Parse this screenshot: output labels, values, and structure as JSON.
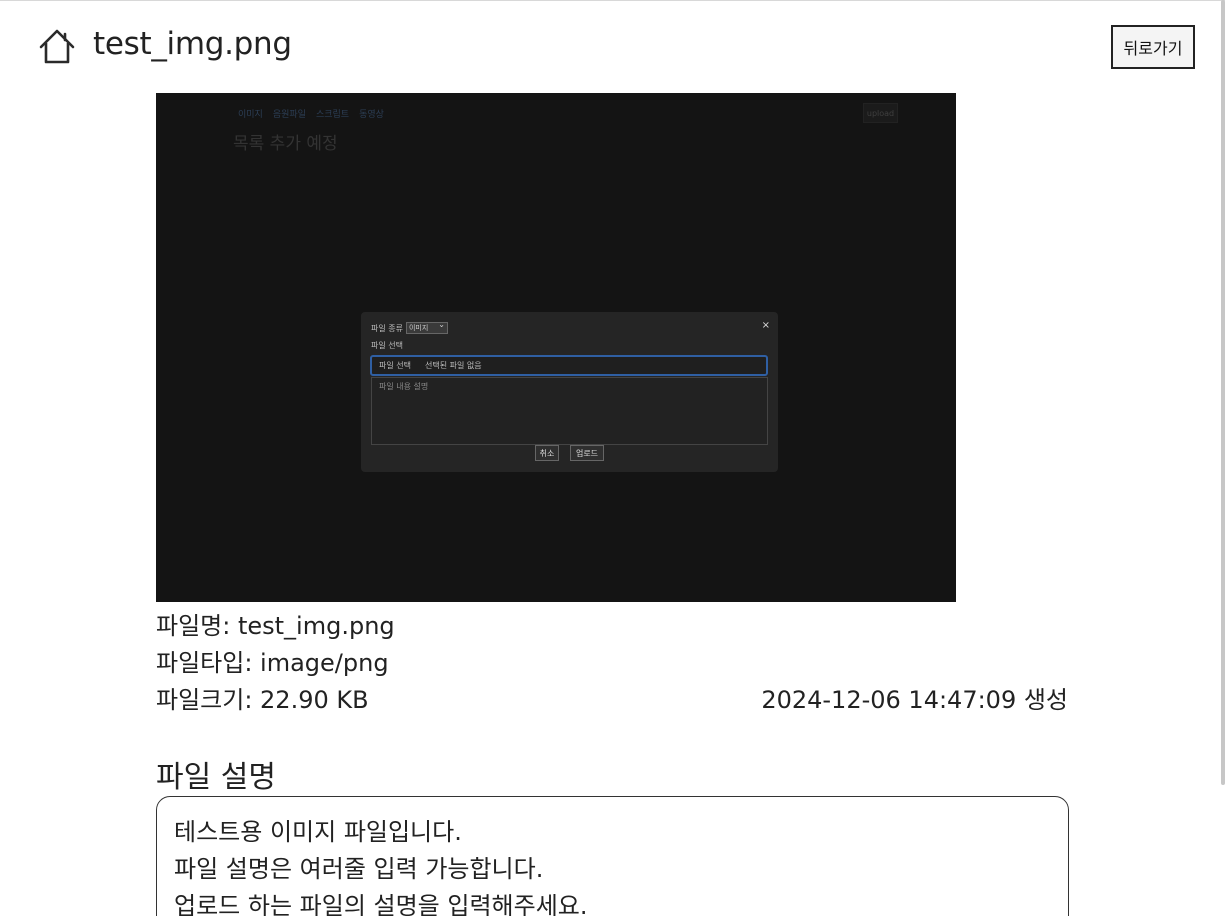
{
  "header": {
    "title": "test_img.png",
    "back_label": "뒤로가기",
    "home_icon": "home-icon"
  },
  "preview": {
    "nav": [
      "이미지",
      "음원파일",
      "스크립트",
      "동영상"
    ],
    "upload_label": "upload",
    "heading": "목록 추가 예정",
    "modal": {
      "type_label": "파일 종류",
      "type_value": "이미지",
      "close": "×",
      "select_label": "파일 선택",
      "file_button": "파일 선택",
      "file_status": "선택된 파일 없음",
      "description_placeholder": "파일 내용 설명",
      "cancel_label": "취소",
      "upload_label": "업로드"
    }
  },
  "meta": {
    "name": "파일명: test_img.png",
    "type": "파일타입: image/png",
    "size": "파일크기: 22.90 KB",
    "created": "2024-12-06 14:47:09 생성"
  },
  "description": {
    "heading": "파일 설명",
    "body": "테스트용 이미지 파일입니다.\n파일 설명은 여러줄 입력 가능합니다.\n업로드 하는 파일의 설명을 입력해주세요."
  },
  "colors": {
    "preview_bg": "#141414",
    "modal_bg": "#252525",
    "focus_border": "#2f5fa3"
  }
}
